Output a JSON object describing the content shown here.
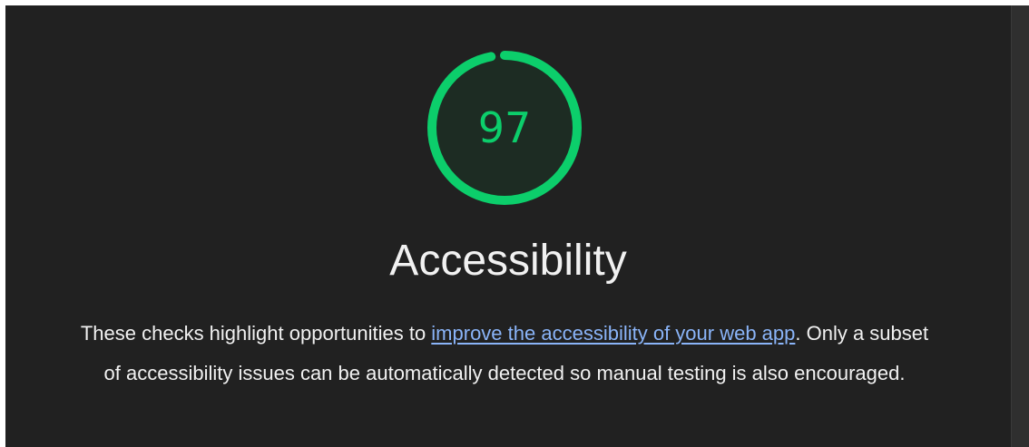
{
  "gauge": {
    "score": "97",
    "score_fraction": 0.97,
    "color": "#0cce6b",
    "fill_color": "#1d2c23",
    "track_color": "#1f3a2a"
  },
  "category": {
    "title": "Accessibility"
  },
  "description": {
    "text_before": "These checks highlight opportunities to ",
    "link_text": "improve the accessibility of your web app",
    "text_after": ". Only a subset of accessibility issues can be automatically detected so manual testing is also encouraged."
  },
  "colors": {
    "panel_bg": "#212121",
    "text": "#f1f1f1",
    "link": "#8ab4f8"
  }
}
